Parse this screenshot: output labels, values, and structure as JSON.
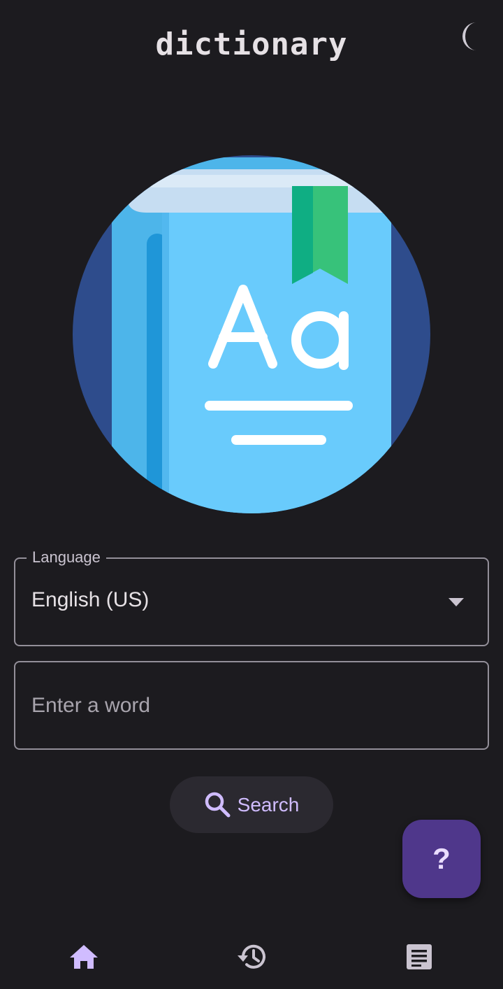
{
  "header": {
    "title": "dictionary",
    "theme_icon": "moon-icon"
  },
  "form": {
    "language_label": "Language",
    "language_value": "English (US)",
    "word_placeholder": "Enter a word"
  },
  "actions": {
    "search_label": "Search",
    "help_label": "?"
  },
  "bottom_nav": {
    "items": [
      {
        "icon": "home-icon",
        "active": true
      },
      {
        "icon": "history-icon",
        "active": false
      },
      {
        "icon": "notes-icon",
        "active": false
      }
    ]
  },
  "colors": {
    "background": "#1c1b1f",
    "accent": "#d0bcff",
    "fab": "#4f378b",
    "outline": "#938f99"
  }
}
